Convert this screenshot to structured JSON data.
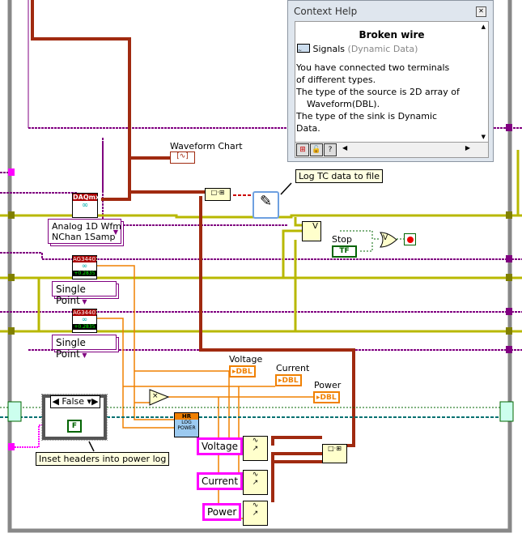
{
  "context_help": {
    "title": "Context Help",
    "heading": "Broken wire",
    "type_name": "Signals",
    "type_detail": "(Dynamic Data)",
    "lines": [
      "You have connected two terminals",
      "of different types.",
      "The type of the source is 2D array of",
      "Waveform(DBL).",
      "The type of the sink is Dynamic",
      "Data."
    ],
    "toolbar": [
      "show-optional-terminals-icon",
      "lock-icon",
      "help-icon"
    ]
  },
  "diagram": {
    "waveform_chart_label": "Waveform Chart",
    "log_note": "Log TC data to file",
    "daqmx_header": "DAQmx",
    "daqmx_mode": "Analog 1D Wfm\nNChan 1Samp",
    "ag_header": "AG34401",
    "ag_reading": "+0.2835",
    "single_point_1": "Single Point",
    "single_point_2": "Single Point",
    "stop_label": "Stop",
    "stop_value": "TF",
    "voltage_label": "Voltage",
    "current_label": "Current",
    "power_label": "Power",
    "dbl": "DBL",
    "case_selector": "False",
    "false_const": "F",
    "inset_note": "Inset headers into power log",
    "log_power_top": "HR",
    "log_power": "LOG\nPOWER",
    "voltage_const": "Voltage",
    "current_const": "Current",
    "power_const": "Power",
    "multiply": "×",
    "or": "V",
    "unbundle": "V"
  },
  "colors": {
    "error_wire": "#b8b800",
    "refnum_wire": "#800080",
    "waveform_wire": "#a02a10",
    "dbl_wire": "#f08000",
    "bool_wire": "#006400",
    "string_wire": "#ff00ff"
  }
}
